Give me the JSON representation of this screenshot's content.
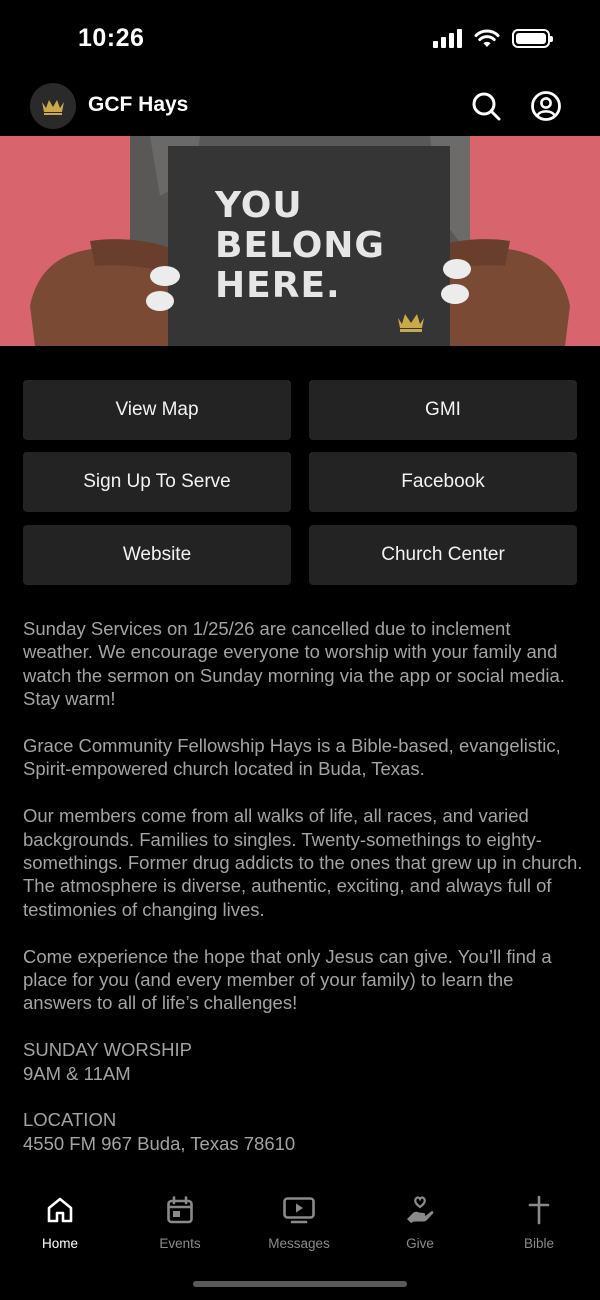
{
  "status_bar": {
    "time": "10:26"
  },
  "header": {
    "title": "GCF Hays",
    "logo_icon": "crown-icon",
    "search_icon": "search-icon",
    "profile_icon": "user-circle-icon"
  },
  "hero": {
    "line1": "YOU",
    "line2": "BELONG",
    "line3": "HERE.",
    "colors": {
      "background": "#d8646e",
      "card": "#353535",
      "crown": "#c9a94a"
    }
  },
  "buttons": {
    "view_map": "View Map",
    "gmi": "GMI",
    "sign_up_to_serve": "Sign Up To Serve",
    "facebook": "Facebook",
    "website": "Website",
    "church_center": "Church Center"
  },
  "content": {
    "paragraph1": "Sunday Services on 1/25/26 are cancelled due to inclement weather. We encourage everyone to worship with your family and  watch the sermon on Sunday morning via the app or social media. Stay warm!",
    "paragraph2": "Grace Community Fellowship Hays is a Bible-based, evangelistic, Spirit-empowered church located in Buda, Texas.",
    "paragraph3": "Our members come from all walks of life, all races, and varied backgrounds. Families to singles. Twenty-somethings to eighty-somethings. Former drug addicts to the ones that grew up in church. The atmosphere is diverse, authentic, exciting, and always full of testimonies of changing lives.",
    "paragraph4": "Come experience the hope that only Jesus can give. You’ll find a place for you (and every member of your family) to learn the answers to all of life’s challenges!",
    "worship_heading": "SUNDAY WORSHIP",
    "worship_times": "9AM & 11AM",
    "location_heading": "LOCATION",
    "location_address": "4550 FM 967 Buda, Texas 78610"
  },
  "tabs": [
    {
      "label": "Home",
      "icon": "home-icon",
      "active": true
    },
    {
      "label": "Events",
      "icon": "calendar-icon",
      "active": false
    },
    {
      "label": "Messages",
      "icon": "video-icon",
      "active": false
    },
    {
      "label": "Give",
      "icon": "give-hand-icon",
      "active": false
    },
    {
      "label": "Bible",
      "icon": "cross-icon",
      "active": false
    }
  ],
  "colors": {
    "background": "#000000",
    "button_bg": "#232323",
    "body_text": "#a3a3a3",
    "tab_inactive": "#8a8a8a"
  }
}
